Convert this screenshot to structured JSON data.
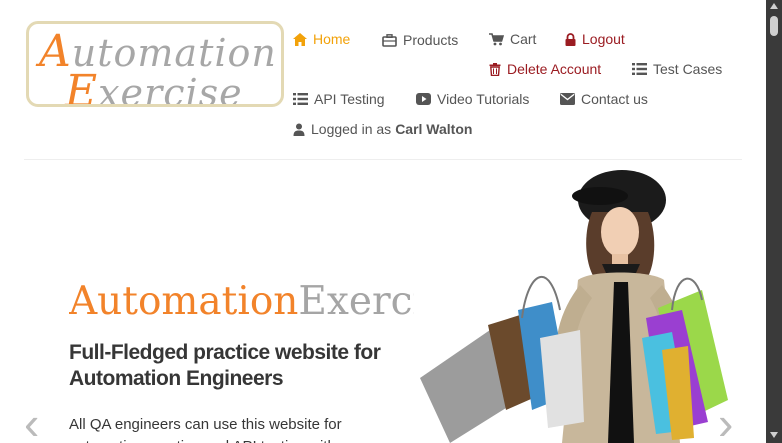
{
  "logo": {
    "cap1": "A",
    "rest1": "utomation",
    "cap2": "E",
    "rest2": "xercise"
  },
  "nav": {
    "home": "Home",
    "products": "Products",
    "cart": "Cart",
    "logout": "Logout",
    "delete_account": "Delete Account",
    "test_cases": "Test Cases",
    "api_testing": "API Testing",
    "video_tutorials": "Video Tutorials",
    "contact_us": "Contact us",
    "logged_in_prefix": "Logged in as",
    "logged_in_user": "Carl Walton"
  },
  "hero": {
    "title_a": "Automation",
    "title_b": "Exercise",
    "subtitle": "Full-Fledged practice website for Automation Engineers",
    "description": "All QA engineers can use this website for automation practice and API testing with"
  },
  "carousel": {
    "prev": "‹",
    "next": "›"
  },
  "colors": {
    "accent": "#f2a20a",
    "logo_orange": "#f2832a",
    "danger": "#9b1c22",
    "text": "#555555"
  },
  "icons": [
    "home-icon",
    "briefcase-icon",
    "cart-icon",
    "lock-icon",
    "trash-icon",
    "list-icon",
    "video-icon",
    "envelope-icon",
    "user-icon"
  ]
}
